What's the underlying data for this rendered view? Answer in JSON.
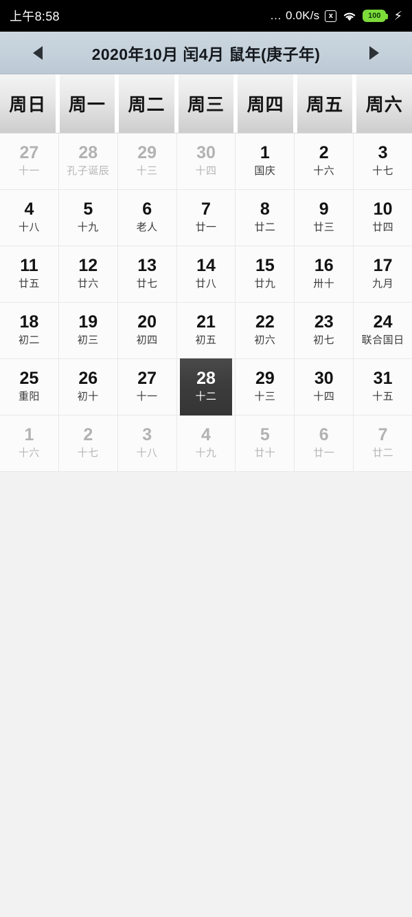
{
  "statusbar": {
    "time": "上午8:58",
    "dots": "…",
    "net_speed": "0.0K/s",
    "sim_icon": "x",
    "battery_level": "100",
    "icons": [
      "no-sim-icon",
      "wifi-icon",
      "battery-icon",
      "charging-bolt-icon"
    ]
  },
  "header": {
    "prev_label": "◀",
    "next_label": "▶",
    "title": "2020年10月 闰4月 鼠年(庚子年)",
    "gregorian_year": "2020",
    "gregorian_month": "10",
    "leap_month": "闰4月",
    "zodiac_year": "鼠年(庚子年)"
  },
  "weekdays": [
    "周日",
    "周一",
    "周二",
    "周三",
    "周四",
    "周五",
    "周六"
  ],
  "selected_day": "28",
  "colors": {
    "header_bg": "#c4d0da",
    "selected_bg": "#3c3c3c",
    "battery_green": "#7ddb3a",
    "other_month_text": "#b2b2b2",
    "current_month_text": "#121212"
  },
  "weeks": [
    [
      {
        "day": "27",
        "lunar": "十一",
        "other": true,
        "selected": false
      },
      {
        "day": "28",
        "lunar": "孔子诞辰",
        "other": true,
        "selected": false
      },
      {
        "day": "29",
        "lunar": "十三",
        "other": true,
        "selected": false
      },
      {
        "day": "30",
        "lunar": "十四",
        "other": true,
        "selected": false
      },
      {
        "day": "1",
        "lunar": "国庆",
        "other": false,
        "selected": false
      },
      {
        "day": "2",
        "lunar": "十六",
        "other": false,
        "selected": false
      },
      {
        "day": "3",
        "lunar": "十七",
        "other": false,
        "selected": false
      }
    ],
    [
      {
        "day": "4",
        "lunar": "十八",
        "other": false,
        "selected": false
      },
      {
        "day": "5",
        "lunar": "十九",
        "other": false,
        "selected": false
      },
      {
        "day": "6",
        "lunar": "老人",
        "other": false,
        "selected": false
      },
      {
        "day": "7",
        "lunar": "廿一",
        "other": false,
        "selected": false
      },
      {
        "day": "8",
        "lunar": "廿二",
        "other": false,
        "selected": false
      },
      {
        "day": "9",
        "lunar": "廿三",
        "other": false,
        "selected": false
      },
      {
        "day": "10",
        "lunar": "廿四",
        "other": false,
        "selected": false
      }
    ],
    [
      {
        "day": "11",
        "lunar": "廿五",
        "other": false,
        "selected": false
      },
      {
        "day": "12",
        "lunar": "廿六",
        "other": false,
        "selected": false
      },
      {
        "day": "13",
        "lunar": "廿七",
        "other": false,
        "selected": false
      },
      {
        "day": "14",
        "lunar": "廿八",
        "other": false,
        "selected": false
      },
      {
        "day": "15",
        "lunar": "廿九",
        "other": false,
        "selected": false
      },
      {
        "day": "16",
        "lunar": "卅十",
        "other": false,
        "selected": false
      },
      {
        "day": "17",
        "lunar": "九月",
        "other": false,
        "selected": false
      }
    ],
    [
      {
        "day": "18",
        "lunar": "初二",
        "other": false,
        "selected": false
      },
      {
        "day": "19",
        "lunar": "初三",
        "other": false,
        "selected": false
      },
      {
        "day": "20",
        "lunar": "初四",
        "other": false,
        "selected": false
      },
      {
        "day": "21",
        "lunar": "初五",
        "other": false,
        "selected": false
      },
      {
        "day": "22",
        "lunar": "初六",
        "other": false,
        "selected": false
      },
      {
        "day": "23",
        "lunar": "初七",
        "other": false,
        "selected": false
      },
      {
        "day": "24",
        "lunar": "联合国日",
        "other": false,
        "selected": false
      }
    ],
    [
      {
        "day": "25",
        "lunar": "重阳",
        "other": false,
        "selected": false
      },
      {
        "day": "26",
        "lunar": "初十",
        "other": false,
        "selected": false
      },
      {
        "day": "27",
        "lunar": "十一",
        "other": false,
        "selected": false
      },
      {
        "day": "28",
        "lunar": "十二",
        "other": false,
        "selected": true
      },
      {
        "day": "29",
        "lunar": "十三",
        "other": false,
        "selected": false
      },
      {
        "day": "30",
        "lunar": "十四",
        "other": false,
        "selected": false
      },
      {
        "day": "31",
        "lunar": "十五",
        "other": false,
        "selected": false
      }
    ],
    [
      {
        "day": "1",
        "lunar": "十六",
        "other": true,
        "selected": false
      },
      {
        "day": "2",
        "lunar": "十七",
        "other": true,
        "selected": false
      },
      {
        "day": "3",
        "lunar": "十八",
        "other": true,
        "selected": false
      },
      {
        "day": "4",
        "lunar": "十九",
        "other": true,
        "selected": false
      },
      {
        "day": "5",
        "lunar": "廿十",
        "other": true,
        "selected": false
      },
      {
        "day": "6",
        "lunar": "廿一",
        "other": true,
        "selected": false
      },
      {
        "day": "7",
        "lunar": "廿二",
        "other": true,
        "selected": false
      }
    ]
  ]
}
